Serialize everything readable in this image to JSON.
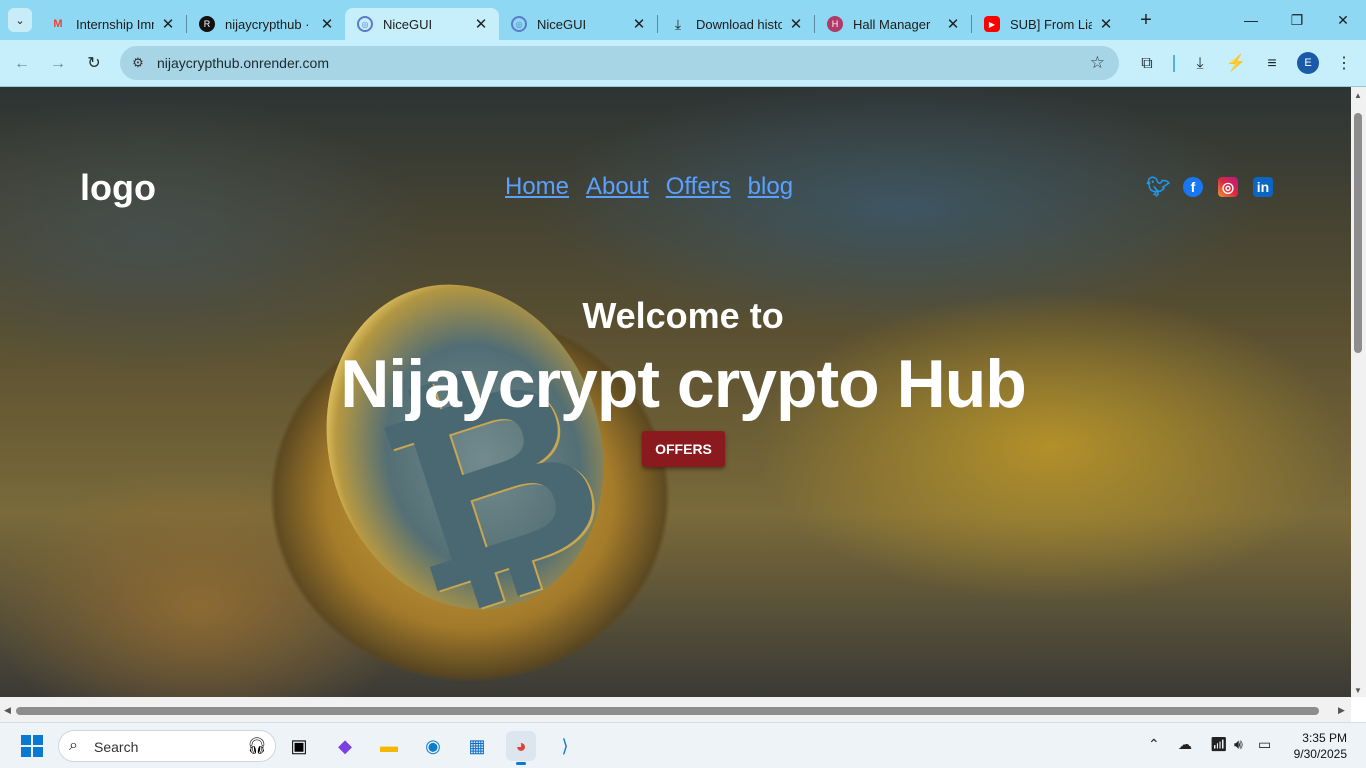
{
  "browser": {
    "tabs": [
      {
        "title": "Internship Imme",
        "icon": "gmail-icon"
      },
      {
        "title": "nijaycrypthub · ",
        "icon": "render-icon"
      },
      {
        "title": "NiceGUI",
        "icon": "globe-icon",
        "active": true
      },
      {
        "title": "NiceGUI",
        "icon": "globe-icon"
      },
      {
        "title": "Download histor",
        "icon": "download-icon"
      },
      {
        "title": "Hall Manager",
        "icon": "app-icon"
      },
      {
        "title": "SUB] From Liar i",
        "icon": "youtube-icon"
      }
    ],
    "url": "nijaycrypthub.onrender.com",
    "profile_initial": "E"
  },
  "page": {
    "logo_text": "logo",
    "nav": [
      "Home",
      "About",
      "Offers",
      "blog"
    ],
    "welcome": "Welcome to",
    "title": "Nijaycrypt crypto Hub",
    "cta": "OFFERS",
    "link_color": "#5aa0ff",
    "cta_color": "#8b1a1f"
  },
  "taskbar": {
    "search_placeholder": "Search",
    "time": "3:35 PM",
    "date": "9/30/2025"
  }
}
